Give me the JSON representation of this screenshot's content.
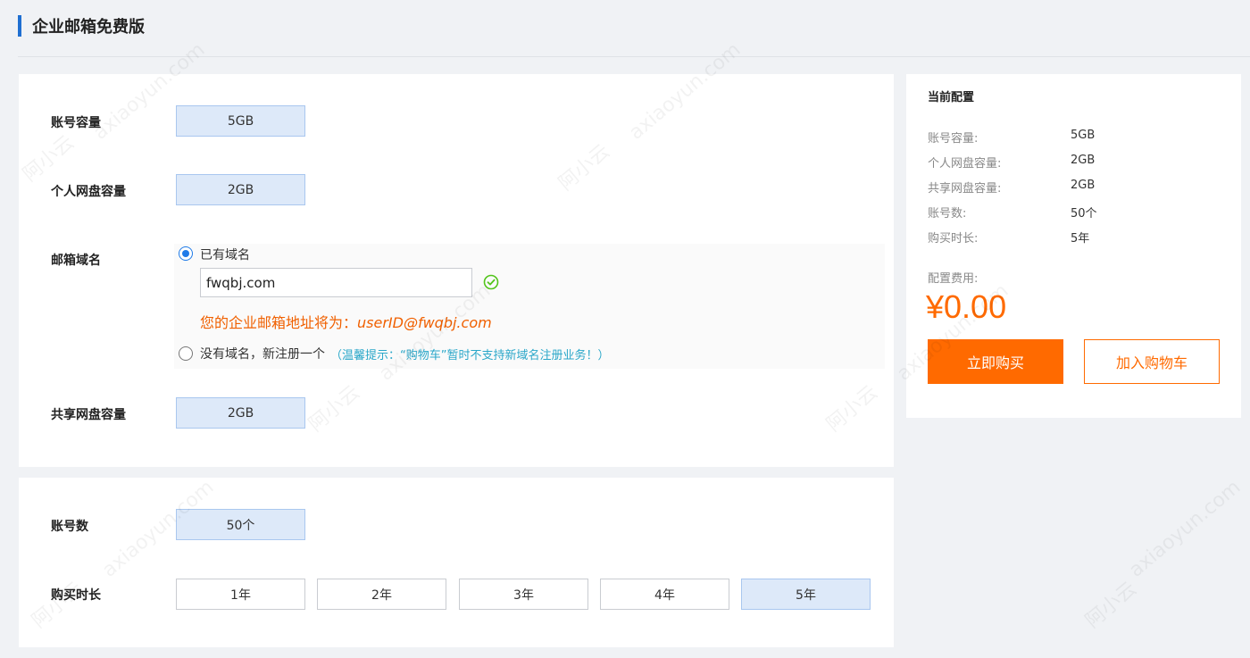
{
  "page": {
    "title": "企业邮箱免费版"
  },
  "main": {
    "capacity": {
      "label": "账号容量",
      "value": "5GB"
    },
    "personal_disk": {
      "label": "个人网盘容量",
      "value": "2GB"
    },
    "domain": {
      "label": "邮箱域名",
      "option_existing": "已有域名",
      "input_value": "fwqbj.com",
      "address_prefix": "您的企业邮箱地址将为：",
      "address_value": "userID@fwqbj.com",
      "option_new": "没有域名，新注册一个",
      "tip": "（温馨提示：“购物车”暂时不支持新域名注册业务！）"
    },
    "shared_disk": {
      "label": "共享网盘容量",
      "value": "2GB"
    },
    "accounts": {
      "label": "账号数",
      "value": "50个"
    },
    "duration": {
      "label": "购买时长",
      "options": [
        "1年",
        "2年",
        "3年",
        "4年",
        "5年"
      ],
      "selected": "5年"
    }
  },
  "sidebar": {
    "title": "当前配置",
    "rows": [
      {
        "label": "账号容量:",
        "value": "5GB"
      },
      {
        "label": "个人网盘容量:",
        "value": "2GB"
      },
      {
        "label": "共享网盘容量:",
        "value": "2GB"
      },
      {
        "label": "账号数:",
        "value": "50个"
      },
      {
        "label": "购买时长:",
        "value": "5年"
      }
    ],
    "fee_label": "配置费用:",
    "price": "¥0.00",
    "buy_label": "立即购买",
    "cart_label": "加入购物车"
  },
  "colors": {
    "accent": "#ff6a00",
    "selected_bg": "#dde9f9",
    "title_bar": "#1f6fd1",
    "tip": "#2aa7c9",
    "check": "#52c41a"
  },
  "watermark": [
    "阿小云",
    "axiaoyun.com"
  ]
}
